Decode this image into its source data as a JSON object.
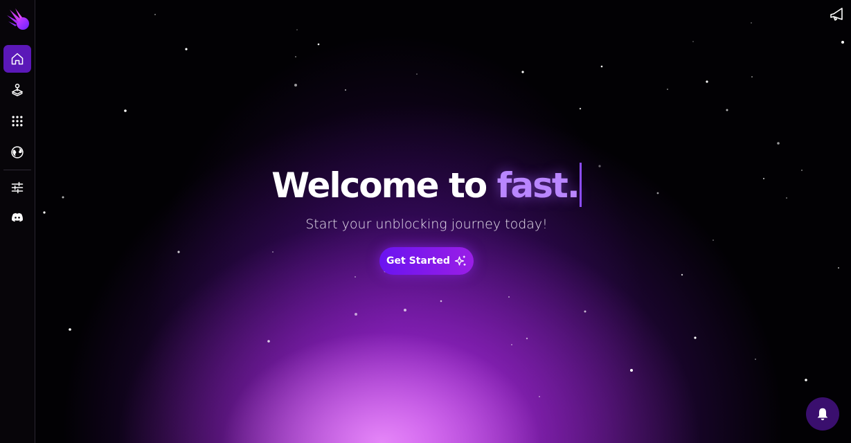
{
  "sidebar": {
    "logo": "fast-rocket-logo",
    "items": [
      {
        "icon": "home-icon",
        "active": true
      },
      {
        "icon": "joystick-icon",
        "active": false
      },
      {
        "icon": "apps-grid-icon",
        "active": false
      },
      {
        "icon": "globe-icon",
        "active": false
      },
      {
        "icon": "sliders-icon",
        "active": false
      },
      {
        "icon": "discord-icon",
        "active": false
      }
    ]
  },
  "hero": {
    "title_prefix": "Welcome to ",
    "title_accent": "fast.",
    "subtitle": "Start your unblocking journey today!",
    "cta_label": "Get Started",
    "cta_icon": "sparkles-icon"
  },
  "header": {
    "announcement_icon": "megaphone-icon"
  },
  "notifications": {
    "icon": "bell-icon"
  },
  "colors": {
    "accent": "#5b18b8",
    "title_accent": "#b986ff",
    "cta_start": "#6a14f0",
    "cta_end": "#9a1ee6",
    "background": "#020104"
  }
}
